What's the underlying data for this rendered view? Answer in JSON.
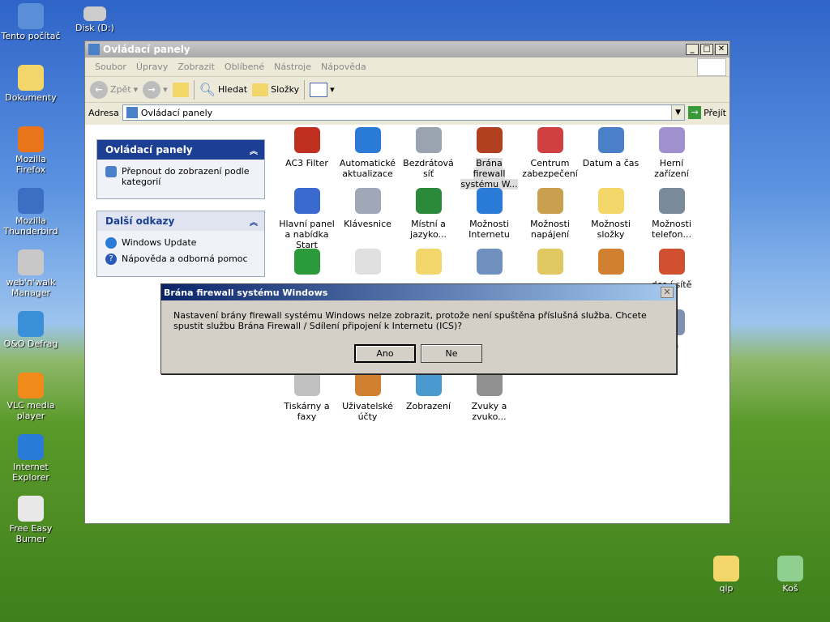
{
  "desktop": {
    "left_icons": [
      {
        "label": "Tento počítač",
        "color": "#5a8fd8"
      },
      {
        "label": "Dokumenty",
        "color": "#f3d66a"
      },
      {
        "label": "Mozilla Firefox",
        "color": "#e8751a"
      },
      {
        "label": "Mozilla Thunderbird",
        "color": "#3a6fc4"
      },
      {
        "label": "web'n'walk Manager",
        "color": "#c8c8c8"
      },
      {
        "label": "O&O Defrag",
        "color": "#3a8fd8"
      },
      {
        "label": "VLC media player",
        "color": "#f08a1a"
      },
      {
        "label": "Internet Explorer",
        "color": "#2a7ad8"
      },
      {
        "label": "Free Easy Burner",
        "color": "#e8e8e8"
      }
    ],
    "disk": "Disk (D:)",
    "right_icons": [
      {
        "label": "qip",
        "color": "#f3d66a"
      },
      {
        "label": "Koš",
        "color": "#8fcf8f"
      }
    ]
  },
  "window": {
    "title": "Ovládací panely",
    "menu": [
      "Soubor",
      "Úpravy",
      "Zobrazit",
      "Oblíbené",
      "Nástroje",
      "Nápověda"
    ],
    "toolbar": {
      "back": "Zpět",
      "search": "Hledat",
      "folders": "Složky"
    },
    "address": {
      "label": "Adresa",
      "value": "Ovládací panely",
      "go": "Přejít"
    },
    "left_pane": {
      "panel1": {
        "title": "Ovládací panely",
        "items": [
          "Přepnout do zobrazení podle kategorií"
        ]
      },
      "panel2": {
        "title": "Další odkazy",
        "items": [
          "Windows Update",
          "Nápověda a odborná pomoc"
        ]
      }
    },
    "items": [
      {
        "label": "AC3 Filter",
        "color": "#c03020"
      },
      {
        "label": "Automatické aktualizace",
        "color": "#2a7ad8"
      },
      {
        "label": "Bezdrátová síť",
        "color": "#9aa4b0"
      },
      {
        "label": "Brána firewall systému W...",
        "color": "#b04020"
      },
      {
        "label": "Centrum zabezpečení",
        "color": "#d04040"
      },
      {
        "label": "Datum a čas",
        "color": "#4a80c8"
      },
      {
        "label": "Herní zařízení",
        "color": "#a090d0"
      },
      {
        "label": "Hlavní panel a nabídka Start",
        "color": "#3a6ad0"
      },
      {
        "label": "Klávesnice",
        "color": "#a0a8b8"
      },
      {
        "label": "Místní a jazyko...",
        "color": "#2a8a3a"
      },
      {
        "label": "Možnosti Internetu",
        "color": "#2a7ad8"
      },
      {
        "label": "Možnosti napájení",
        "color": "#c8a050"
      },
      {
        "label": "Možnosti složky",
        "color": "#f3d66a"
      },
      {
        "label": "Možnosti telefon...",
        "color": "#7a8a9a"
      },
      {
        "label": "",
        "color": "#2a9a3a"
      },
      {
        "label": "",
        "color": "#e0e0e0"
      },
      {
        "label": "",
        "color": "#f3d66a"
      },
      {
        "label": "",
        "color": "#7090c0"
      },
      {
        "label": "",
        "color": "#e0c860"
      },
      {
        "label": "",
        "color": "#d08030"
      },
      {
        "label": "dce í sítě",
        "color": "#d05030"
      },
      {
        "label": "ém",
        "color": "#8090b0"
      },
      {
        "label": "Tiskárny a faxy",
        "color": "#c0c0c0"
      },
      {
        "label": "Uživatelské účty",
        "color": "#d08030"
      },
      {
        "label": "Zobrazení",
        "color": "#4a9ad0"
      },
      {
        "label": "Zvuky a zvuko...",
        "color": "#909090"
      }
    ]
  },
  "dialog": {
    "title": "Brána firewall systému Windows",
    "message": "Nastavení brány firewall systému Windows nelze zobrazit, protože není spuštěna příslušná služba. Chcete spustit službu Brána Firewall / Sdílení připojení k Internetu (ICS)?",
    "yes": "Ano",
    "no": "Ne"
  }
}
